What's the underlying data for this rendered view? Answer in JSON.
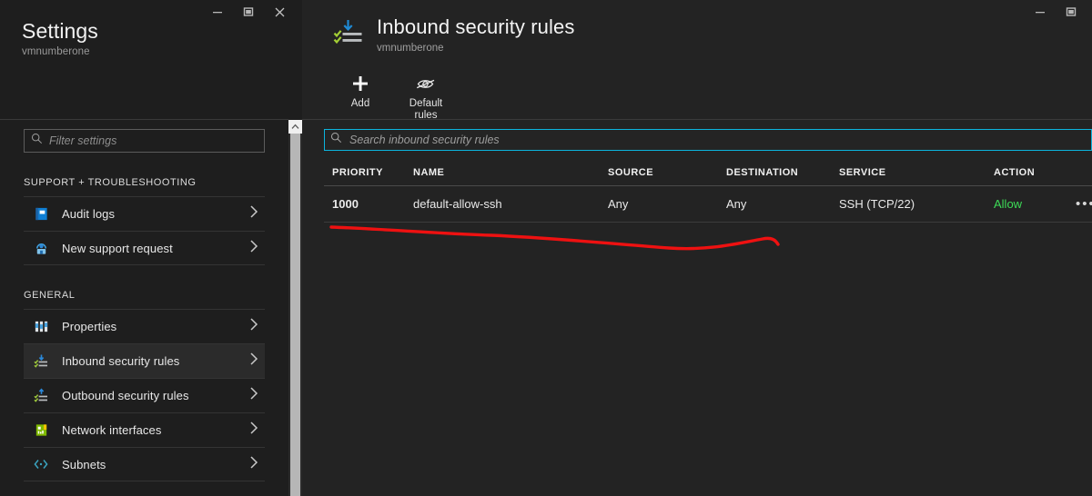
{
  "left_panel": {
    "title": "Settings",
    "subtitle": "vmnumberone",
    "window_controls": [
      {
        "name": "minimize",
        "glyph": "minimize-icon"
      },
      {
        "name": "maximize",
        "glyph": "maximize-icon"
      },
      {
        "name": "close",
        "glyph": "close-icon"
      }
    ],
    "filter": {
      "placeholder": "Filter settings",
      "value": "",
      "icon": "search-icon"
    },
    "groups": [
      {
        "label": "SUPPORT + TROUBLESHOOTING",
        "items": [
          {
            "label": "Audit logs",
            "icon": "audit-logs-icon",
            "selected": false
          },
          {
            "label": "New support request",
            "icon": "support-request-icon",
            "selected": false
          }
        ]
      },
      {
        "label": "GENERAL",
        "items": [
          {
            "label": "Properties",
            "icon": "properties-icon",
            "selected": false
          },
          {
            "label": "Inbound security rules",
            "icon": "inbound-rules-icon",
            "selected": true
          },
          {
            "label": "Outbound security rules",
            "icon": "outbound-rules-icon",
            "selected": false
          },
          {
            "label": "Network interfaces",
            "icon": "network-interfaces-icon",
            "selected": false
          },
          {
            "label": "Subnets",
            "icon": "subnets-icon",
            "selected": false
          }
        ]
      }
    ]
  },
  "right_panel": {
    "title": "Inbound security rules",
    "subtitle": "vmnumberone",
    "icon": "inbound-security-rules-icon",
    "window_controls": [
      {
        "name": "minimize",
        "glyph": "minimize-icon"
      },
      {
        "name": "maximize",
        "glyph": "maximize-icon"
      }
    ],
    "toolbar": [
      {
        "label": "Add",
        "icon": "plus-icon"
      },
      {
        "label": "Default\nrules",
        "label_line1": "Default",
        "label_line2": "rules",
        "icon": "eye-off-icon"
      }
    ],
    "search": {
      "placeholder": "Search inbound security rules",
      "value": "",
      "icon": "search-icon"
    },
    "table": {
      "columns": [
        "PRIORITY",
        "NAME",
        "SOURCE",
        "DESTINATION",
        "SERVICE",
        "ACTION"
      ],
      "rows": [
        {
          "priority": "1000",
          "name": "default-allow-ssh",
          "source": "Any",
          "destination": "Any",
          "service": "SSH (TCP/22)",
          "action": "Allow",
          "more": "•••"
        }
      ]
    }
  },
  "annotation": {
    "type": "freehand-underline",
    "color": "#ee1111"
  },
  "colors": {
    "panel_bg": "#1e1e1e",
    "right_bg": "#232323",
    "selected_row": "#2b2b2b",
    "accent_focus": "#0cb4dd",
    "allow_green": "#3ddc57",
    "annotation_red": "#ee1111"
  }
}
